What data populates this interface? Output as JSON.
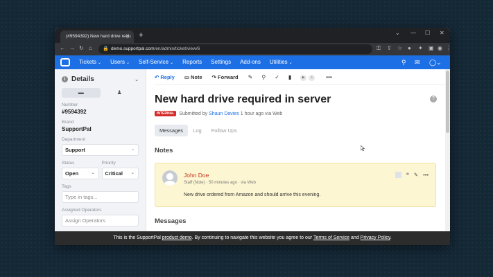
{
  "browser": {
    "tab_title": "(#9594392) New hard drive requ",
    "url_host": "demo.supportpal.com",
    "url_path": "/en/admin/ticket/view/6"
  },
  "nav": {
    "items": [
      {
        "label": "Tickets",
        "dropdown": true
      },
      {
        "label": "Users",
        "dropdown": true
      },
      {
        "label": "Self-Service",
        "dropdown": true
      },
      {
        "label": "Reports",
        "dropdown": false
      },
      {
        "label": "Settings",
        "dropdown": false
      },
      {
        "label": "Add-ons",
        "dropdown": false
      },
      {
        "label": "Utilities",
        "dropdown": true
      }
    ]
  },
  "sidebar": {
    "title": "Details",
    "number_label": "Number",
    "number_value": "#9594392",
    "brand_label": "Brand",
    "brand_value": "SupportPal",
    "department_label": "Department",
    "department_value": "Support",
    "status_label": "Status",
    "status_value": "Open",
    "priority_label": "Priority",
    "priority_value": "Critical",
    "tags_label": "Tags",
    "tags_placeholder": "Type in tags...",
    "assigned_label": "Assigned Operators",
    "assigned_placeholder": "Assign Operators"
  },
  "toolbar": {
    "reply": "Reply",
    "note": "Note",
    "forward": "Forward"
  },
  "ticket": {
    "title": "New hard drive required in server",
    "badge": "INTERNAL",
    "submitted_prefix": "Submitted by",
    "submitter": "Shaun Davies",
    "submitted_suffix": "1 hour ago via Web"
  },
  "tabs": [
    "Messages",
    "Log",
    "Follow Ups"
  ],
  "notes_heading": "Notes",
  "note": {
    "author": "John Doe",
    "role": "Staff (Note)",
    "time": "50 minutes ago",
    "via": "via Web",
    "body": "New drive ordered from Amazon and should arrive this evening."
  },
  "messages_heading": "Messages",
  "banner": {
    "prefix": "This is the SupportPal",
    "link1": "product demo",
    "middle": ". By continuing to navigate this website you agree to our",
    "link2": "Terms of Service",
    "and": "and",
    "link3": "Privacy Policy",
    "end": "."
  },
  "colors": {
    "brand_blue": "#1d6fe5",
    "internal_badge": "#d42a2a",
    "note_background": "#fdf6d2"
  }
}
